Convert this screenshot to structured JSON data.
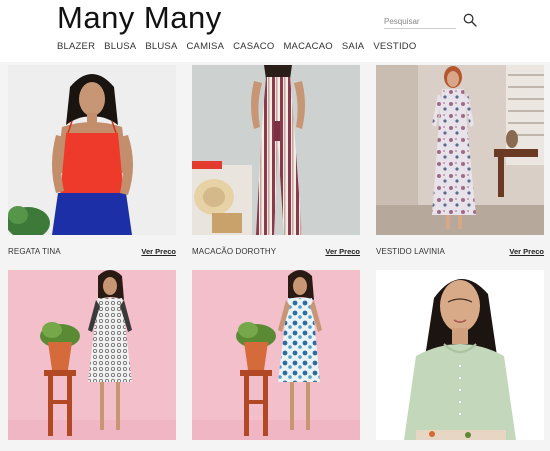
{
  "brand": {
    "logo_text": "Many Many"
  },
  "search": {
    "placeholder": "Pesquisar"
  },
  "nav": {
    "items": [
      "BLAZER",
      "BLUSA",
      "BLUSA",
      "CAMISA",
      "CASACO",
      "MACACAO",
      "SAIA",
      "VESTIDO"
    ]
  },
  "products": [
    {
      "name": "REGATA TINA",
      "price_link": "Ver Preco"
    },
    {
      "name": "MACACÃO DOROTHY",
      "price_link": "Ver Preco"
    },
    {
      "name": "VESTIDO LAVINIA",
      "price_link": "Ver Preco"
    },
    {
      "name": "",
      "price_link": ""
    },
    {
      "name": "",
      "price_link": ""
    },
    {
      "name": "",
      "price_link": ""
    }
  ]
}
